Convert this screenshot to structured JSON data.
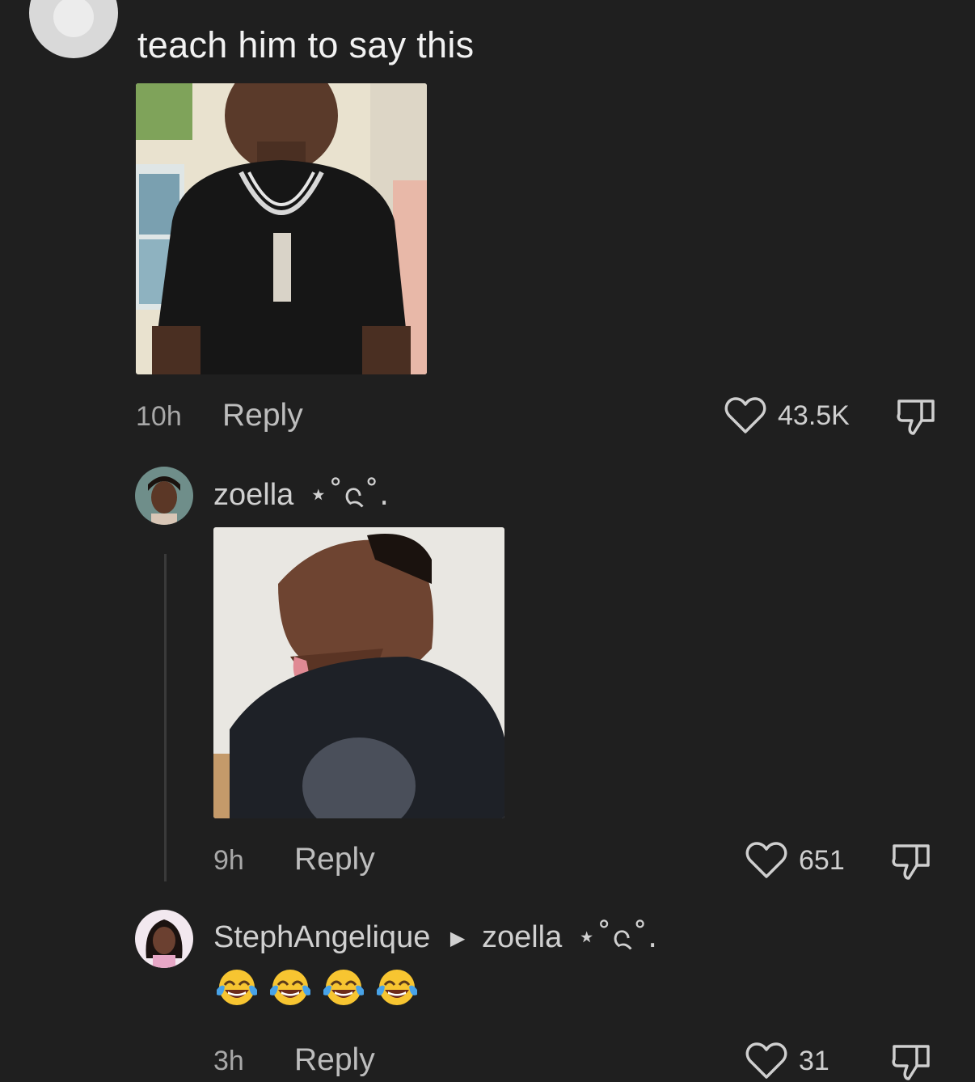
{
  "comment_top": {
    "text": "teach him to say this",
    "time": "10h",
    "reply_label": "Reply",
    "likes": "43.5K"
  },
  "reply_1": {
    "username": "zoella",
    "username_deco": "⋆˚ᨶ˚.",
    "time": "9h",
    "reply_label": "Reply",
    "likes": "651"
  },
  "reply_2": {
    "username": "StephAngelique",
    "reply_to": "zoella",
    "reply_to_deco": "⋆˚ᨶ˚.",
    "text_emojis": [
      "face-with-tears-of-joy",
      "face-with-tears-of-joy",
      "face-with-tears-of-joy",
      "face-with-tears-of-joy"
    ],
    "time": "3h",
    "reply_label": "Reply",
    "likes": "31"
  },
  "icons": {
    "like": "heart-outline-icon",
    "dislike": "thumbs-down-outline-icon",
    "reply_arrow": "caret-right-icon"
  },
  "colors": {
    "background": "#1f1f1f",
    "text_primary": "#f2f2f2",
    "text_secondary": "#a8a8a8"
  }
}
